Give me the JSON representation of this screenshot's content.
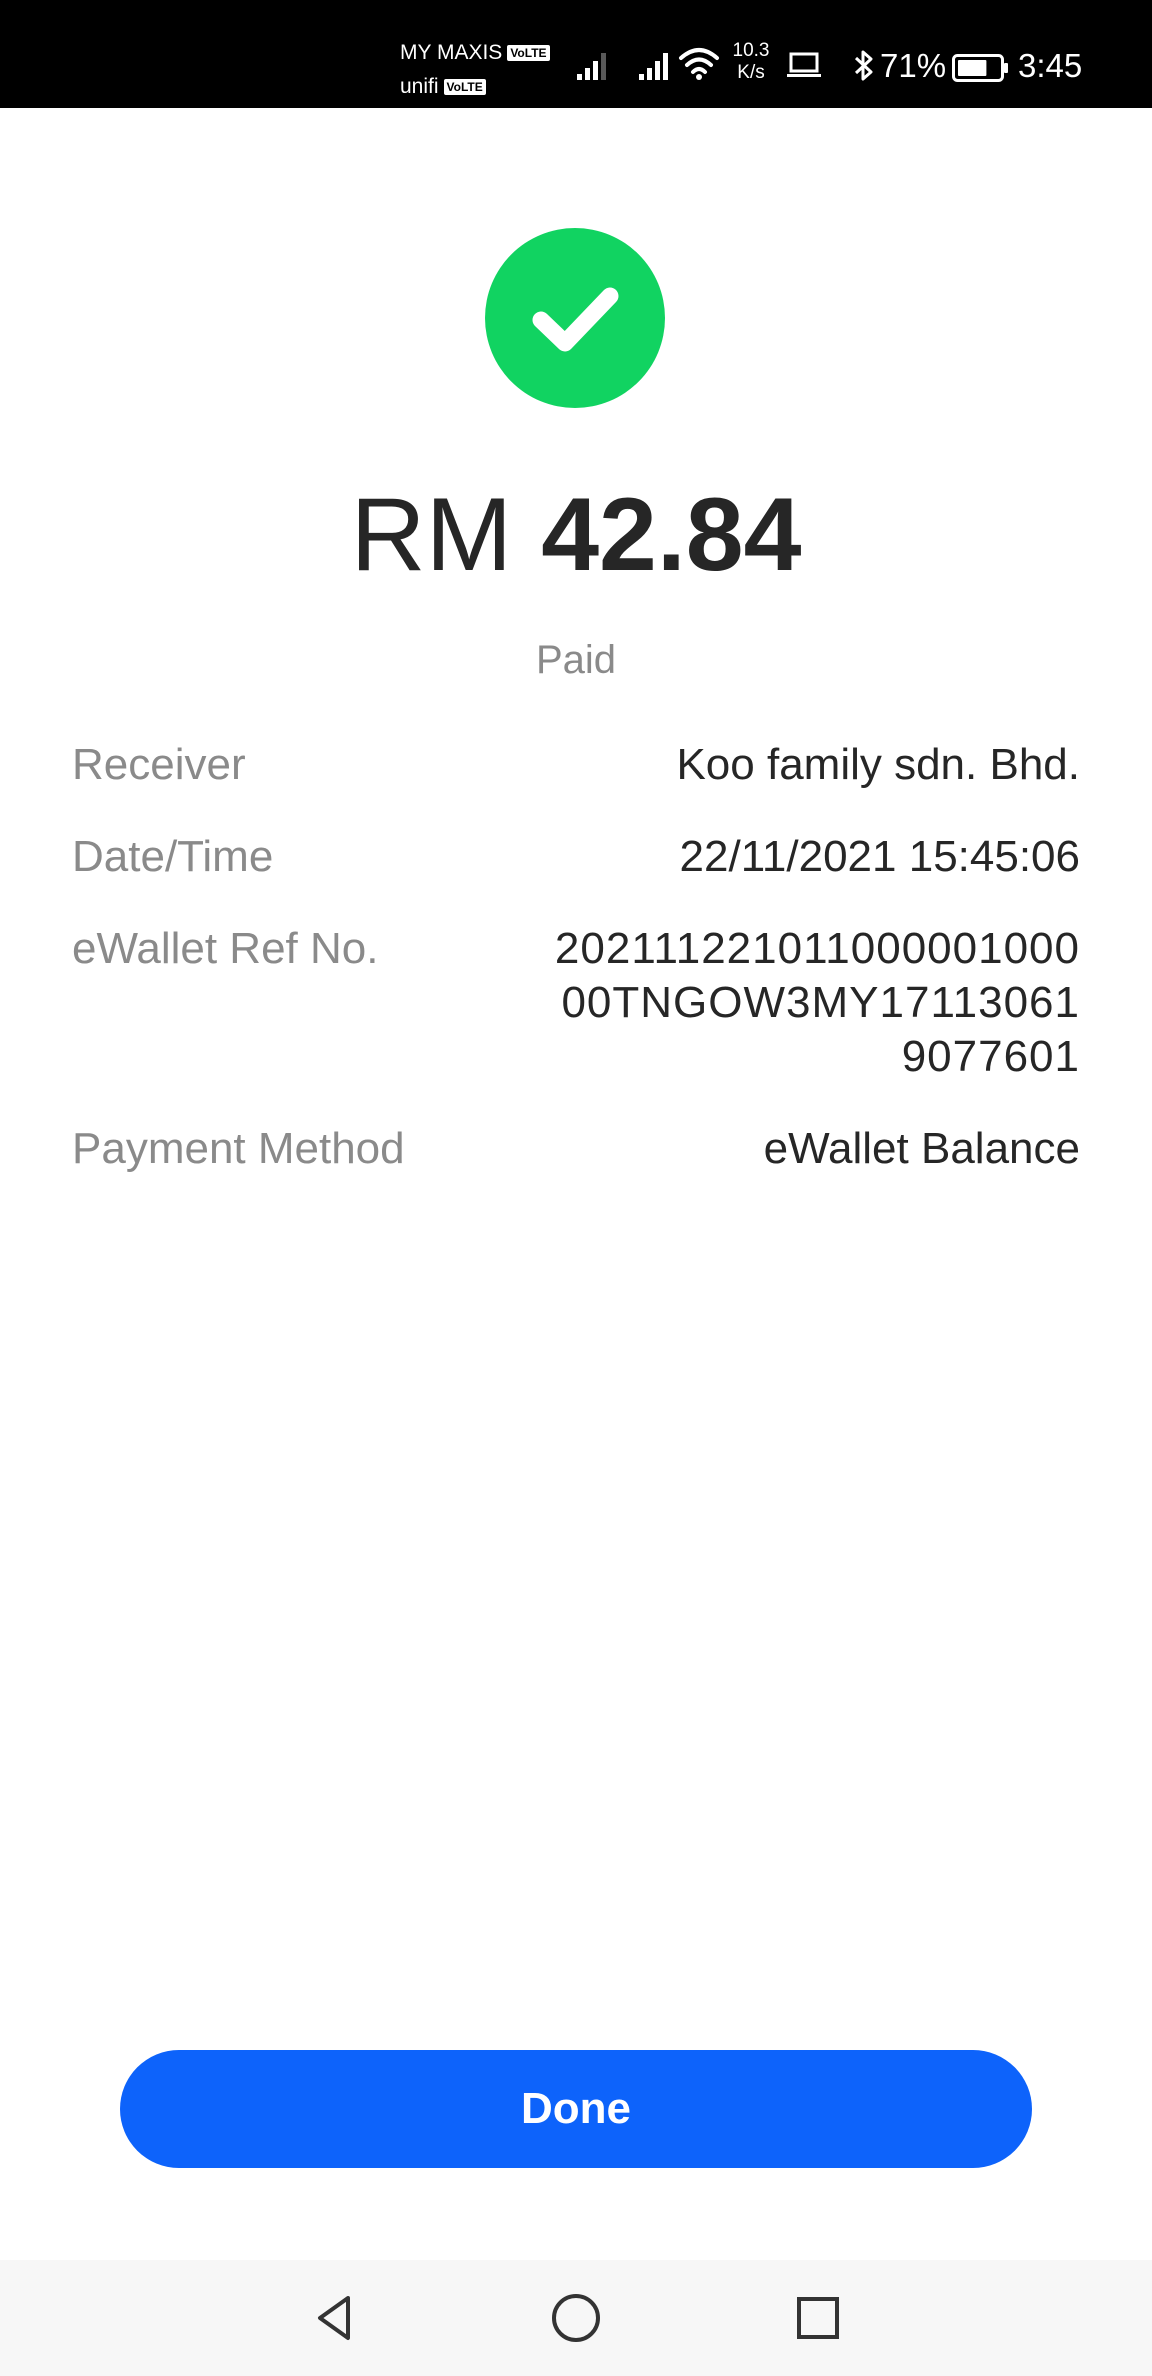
{
  "status_bar": {
    "carrier_1": "MY MAXIS",
    "carrier_2": "unifi",
    "volte_badge": "VoLTE",
    "speed_value": "10.3",
    "speed_unit": "K/s",
    "battery_percent": "71%",
    "battery_level": 0.71,
    "time": "3:45",
    "icons": [
      "signal-icon",
      "signal-icon",
      "wifi-icon",
      "laptop-icon",
      "bluetooth-icon",
      "battery-icon"
    ]
  },
  "receipt": {
    "success_color": "#11d361",
    "currency": "RM",
    "amount": "42.84",
    "status": "Paid",
    "details": [
      {
        "label": "Receiver",
        "value": "Koo family sdn. Bhd."
      },
      {
        "label": "Date/Time",
        "value": "22/11/2021 15:45:06"
      },
      {
        "label": "eWallet Ref No.",
        "value": "20211122101100000100000TNGOW3MY171130619077601"
      },
      {
        "label": "Payment Method",
        "value": "eWallet Balance"
      }
    ]
  },
  "actions": {
    "done_label": "Done",
    "accent_color": "#0d63fb"
  },
  "nav_bar": {
    "icons": [
      "back-icon",
      "home-icon",
      "recent-apps-icon"
    ]
  }
}
